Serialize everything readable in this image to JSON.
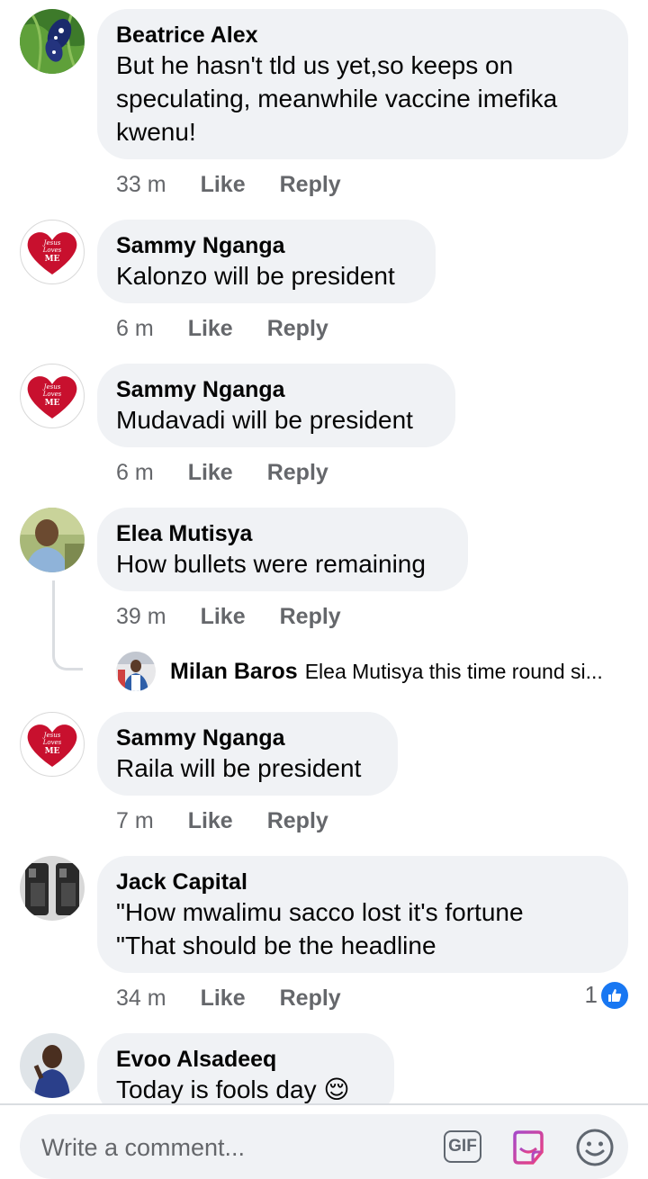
{
  "comments": [
    {
      "author": "Beatrice Alex",
      "lines": [
        "But he hasn't tld us yet,so keeps on",
        "speculating, meanwhile vaccine imefika",
        "kwenu!"
      ],
      "time": "33 m",
      "like": "Like",
      "reply": "Reply",
      "avatar": "butterfly-photo"
    },
    {
      "author": "Sammy Nganga",
      "lines": [
        "Kalonzo will be president"
      ],
      "time": "6 m",
      "like": "Like",
      "reply": "Reply",
      "avatar": "heart-jesus-loves-me"
    },
    {
      "author": "Sammy Nganga",
      "lines": [
        "Mudavadi will be president"
      ],
      "time": "6 m",
      "like": "Like",
      "reply": "Reply",
      "avatar": "heart-jesus-loves-me"
    },
    {
      "author": "Elea Mutisya",
      "lines": [
        "How bullets were remaining"
      ],
      "time": "39 m",
      "like": "Like",
      "reply": "Reply",
      "avatar": "person-photo"
    },
    {
      "author": "Sammy Nganga",
      "lines": [
        "Raila will be president"
      ],
      "time": "7 m",
      "like": "Like",
      "reply": "Reply",
      "avatar": "heart-jesus-loves-me"
    },
    {
      "author": "Jack Capital",
      "lines": [
        "\"How mwalimu sacco lost it's fortune",
        "\"That should be the headline"
      ],
      "time": "34 m",
      "like": "Like",
      "reply": "Reply",
      "avatar": "phone-parts-photo",
      "reaction_count": "1"
    },
    {
      "author": "Evoo Alsadeeq",
      "lines": [
        "Today is fools day 😌"
      ],
      "avatar": "person-photo"
    }
  ],
  "reply_preview": {
    "author": "Milan Baros",
    "text": "Elea Mutisya this time round si..."
  },
  "heart_text": {
    "line1": "Jesus",
    "line2": "Loves",
    "line3": "ME"
  },
  "composer": {
    "placeholder": "Write a comment...",
    "gif_label": "GIF"
  },
  "colors": {
    "bubble": "#f0f2f5",
    "meta": "#65676b",
    "like_blue": "#1877f2",
    "heart_red": "#c8102e",
    "sticker_pink": "#e0407a"
  }
}
